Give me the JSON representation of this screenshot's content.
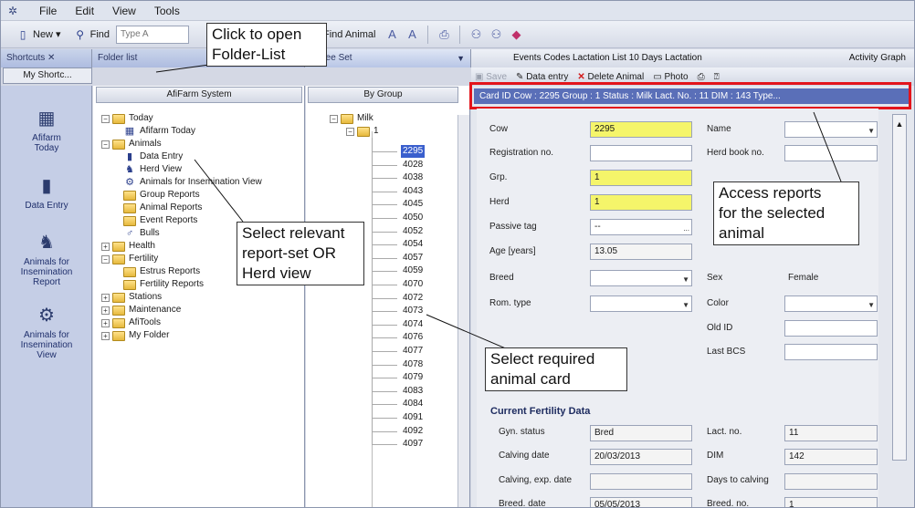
{
  "menu": {
    "items": [
      "File",
      "Edit",
      "View",
      "Tools"
    ]
  },
  "toolbar": {
    "new_label": "New ▾",
    "find_label": "Find",
    "type_placeholder": "Type A",
    "find_animal_label": "Find Animal"
  },
  "panes": {
    "shortcuts_title": "Shortcuts ✕",
    "folder_list_title": "Folder list",
    "tree_set_title": "al tree Set",
    "right_tabs": "Events  Codes  Lactation List  10 Days  Lactation",
    "activity_graph": "Activity Graph"
  },
  "shortcuts": {
    "tab_label": "My Shortc...",
    "items": [
      {
        "label1": "Afifarm",
        "label2": "Today"
      },
      {
        "label1": "Data Entry",
        "label2": ""
      },
      {
        "label1": "Animals for",
        "label2": "Insemination",
        "label3": "Report"
      },
      {
        "label1": "Animals for",
        "label2": "Insemination",
        "label3": "View"
      }
    ]
  },
  "folder": {
    "header": "AfiFarm System",
    "tree": [
      "Today",
      "Afifarm Today",
      "Animals",
      "Data Entry",
      "Herd View",
      "Animals for Insemination View",
      "Group Reports",
      "Animal Reports",
      "Event Reports",
      "Bulls",
      "Health",
      "Fertility",
      "Estrus Reports",
      "Fertility Reports",
      "Stations",
      "Maintenance",
      "AfiTools",
      "My Folder"
    ]
  },
  "group": {
    "header": "By Group",
    "root": "Milk",
    "sub": "1",
    "selected": "2295",
    "numbers": [
      "4028",
      "4038",
      "4043",
      "4045",
      "4050",
      "4052",
      "4054",
      "4057",
      "4059",
      "4070",
      "4072",
      "4073",
      "4074",
      "4076",
      "4077",
      "4078",
      "4079",
      "4083",
      "4084",
      "4091",
      "4092",
      "4097"
    ]
  },
  "card_toolbar": {
    "save": "Save",
    "data_entry": "Data entry",
    "delete": "Delete Animal",
    "photo": "Photo"
  },
  "card_header": "Card ID   Cow : 2295    Group : 1    Status : Milk    Lact. No. : 11    DIM : 143    Type...",
  "card": {
    "cow_label": "Cow",
    "cow_value": "2295",
    "reg_label": "Registration no.",
    "grp_label": "Grp.",
    "grp_value": "1",
    "herd_label": "Herd",
    "herd_value": "1",
    "passive_label": "Passive tag",
    "passive_value": "--",
    "age_label": "Age [years]",
    "age_value": "13.05",
    "breed_label": "Breed",
    "rom_label": "Rom. type",
    "name_label": "Name",
    "herdbook_label": "Herd book no.",
    "sex_label": "Sex",
    "sex_value": "Female",
    "color_label": "Color",
    "oldid_label": "Old ID",
    "lastbcs_label": "Last BCS",
    "fertility_title": "Current Fertility Data",
    "gyn_label": "Gyn. status",
    "gyn_value": "Bred",
    "calving_label": "Calving date",
    "calving_value": "20/03/2013",
    "calvexp_label": "Calving, exp. date",
    "bred_label": "Breed. date",
    "bred_value": "05/05/2013",
    "lactno_label": "Lact. no.",
    "lactno_value": "11",
    "dim_label": "DIM",
    "dim_value": "142",
    "daystocalv_label": "Days to calving",
    "breedno_label": "Breed. no.",
    "breedno_value": "1"
  },
  "callouts": {
    "folder_l1": "Click to open",
    "folder_l2": "Folder-List",
    "report_l1": "Select relevant",
    "report_l2": "report-set OR",
    "report_l3": "Herd view",
    "card_l1": "Select required",
    "card_l2": "animal card",
    "access_l1": "Access reports",
    "access_l2": "for the selected",
    "access_l3": "animal"
  },
  "colors": {
    "highlight": "#e3141b",
    "card_header": "#5a6fb8",
    "yellow_field": "#f5f56a",
    "selected_row": "#3a5fcd"
  }
}
